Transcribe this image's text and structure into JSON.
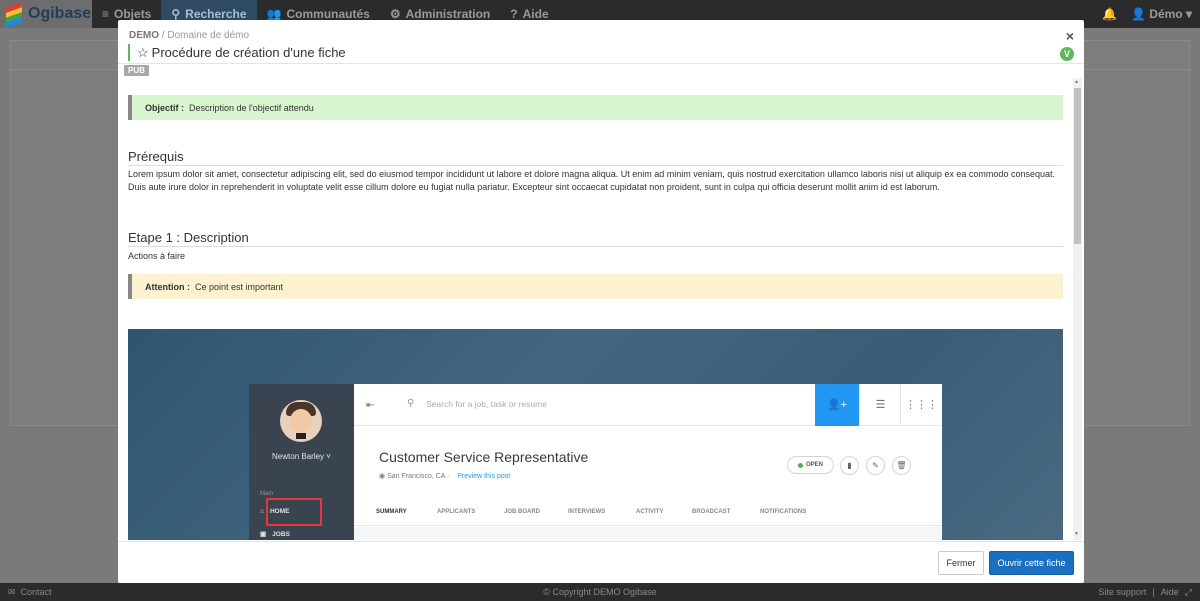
{
  "navbar": {
    "logo_text": "Ogibase",
    "items": [
      {
        "icon": "menu-icon",
        "label": "Objets"
      },
      {
        "icon": "search-icon",
        "label": "Recherche"
      },
      {
        "icon": "users-icon",
        "label": "Communautés"
      },
      {
        "icon": "gears-icon",
        "label": "Administration"
      },
      {
        "icon": "help-icon",
        "label": "Aide"
      }
    ],
    "user_label": "Démo"
  },
  "footer": {
    "contact": "Contact",
    "copyright": "© Copyright DEMO Ogibase",
    "site_support": "Site support",
    "separator": "|",
    "aide": "Aide"
  },
  "modal": {
    "breadcrumb_code": "DEMO",
    "breadcrumb_sep": " / ",
    "breadcrumb_domain": "Domaine de démo",
    "title": "Procédure de création d'une fiche",
    "status_badge": "V",
    "pub_tag": "PUB",
    "objective_label": "Objectif :",
    "objective_text": "Description de l'objectif attendu",
    "prereq_heading": "Prérequis",
    "prereq_text": "Lorem ipsum dolor sit amet, consectetur adipiscing elit, sed do eiusmod tempor incididunt ut labore et dolore magna aliqua. Ut enim ad minim veniam, quis nostrud exercitation ullamco laboris nisi ut aliquip ex ea commodo consequat. Duis aute irure dolor in reprehenderit in voluptate velit esse cillum dolore eu fugiat nulla pariatur. Excepteur sint occaecat cupidatat non proident, sunt in culpa qui officia deserunt mollit anim id est laborum.",
    "step1_heading": "Etape 1 : Description",
    "step1_text": "Actions à faire",
    "attention_label": "Attention :",
    "attention_text": "Ce point est important",
    "close_label": "Fermer",
    "open_label": "Ouvrir cette fiche"
  },
  "screenshot": {
    "user_name": "Newton Barley",
    "side_section": "Main",
    "side_links": [
      "HOME",
      "JOBS"
    ],
    "search_placeholder": "Search for a job, task or resume",
    "job_title": "Customer Service Representative",
    "job_location": "San Francisco, CA",
    "preview_link": "Preview this post",
    "status_pill": "OPEN",
    "tabs": [
      "SUMMARY",
      "APPLICANTS",
      "JOB BOARD",
      "INTERVIEWS",
      "ACTIVITY",
      "BROADCAST",
      "NOTIFICATIONS"
    ]
  }
}
